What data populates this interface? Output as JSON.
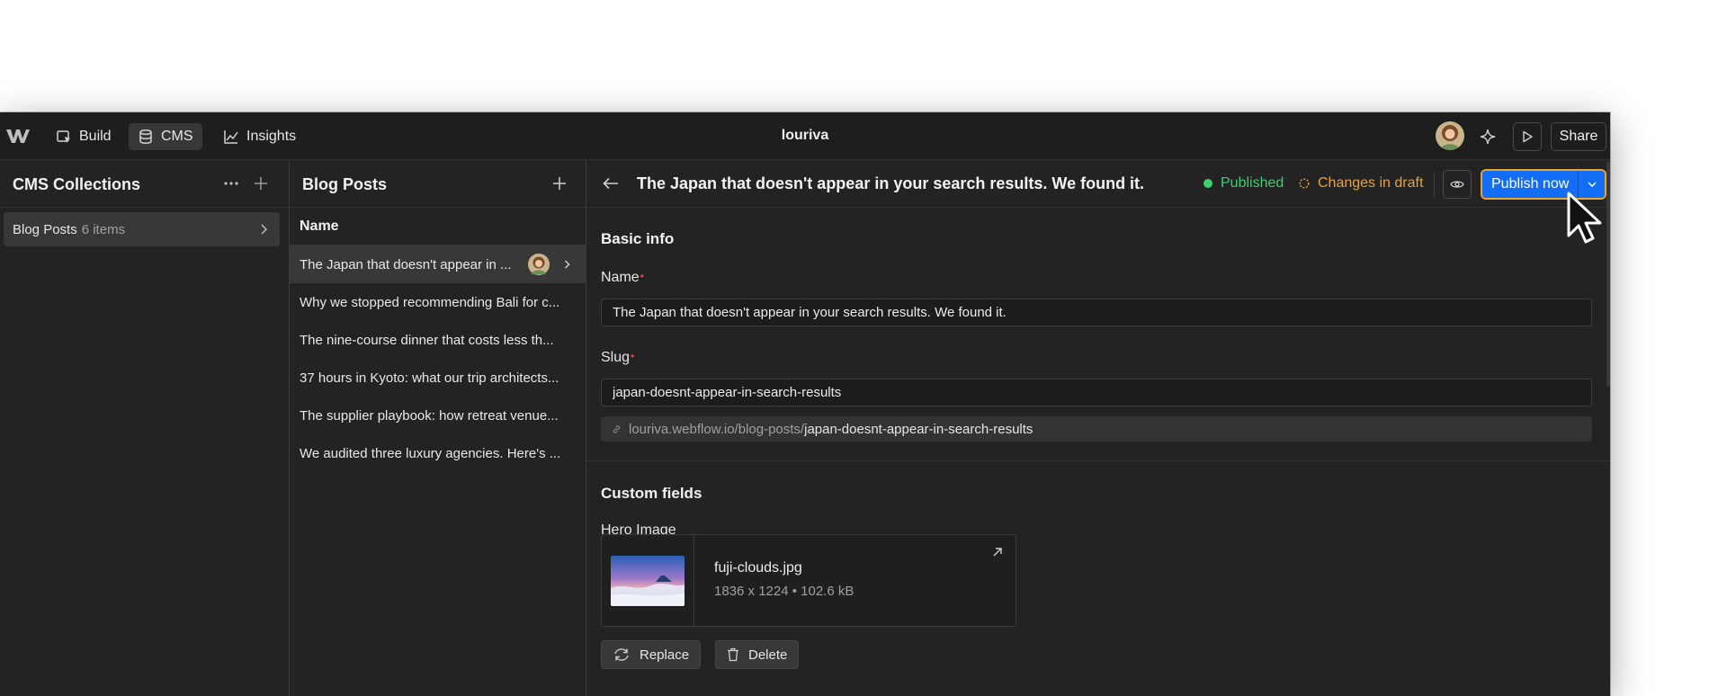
{
  "topbar": {
    "nav": [
      {
        "label": "Build",
        "icon": "build-icon"
      },
      {
        "label": "CMS",
        "icon": "database-icon"
      },
      {
        "label": "Insights",
        "icon": "chart-icon"
      }
    ],
    "site_name": "louriva",
    "share_label": "Share"
  },
  "collections_panel": {
    "title": "CMS Collections",
    "items": [
      {
        "name": "Blog Posts",
        "count": "6 items"
      }
    ]
  },
  "posts_panel": {
    "title": "Blog Posts",
    "column_header": "Name",
    "rows": [
      "The Japan that doesn't appear in ...",
      "Why we stopped recommending Bali for c...",
      "The nine-course dinner that costs less th...",
      "37 hours in Kyoto: what our trip architects...",
      "The supplier playbook: how retreat venue...",
      "We audited three luxury agencies. Here's ..."
    ]
  },
  "editor": {
    "title": "The Japan that doesn't appear in your search results. We found it.",
    "status_published": "Published",
    "status_draft": "Changes in draft",
    "publish_label": "Publish now",
    "basic_info": {
      "heading": "Basic info",
      "name_label": "Name",
      "name_value": "The Japan that doesn't appear in your search results. We found it.",
      "slug_label": "Slug",
      "slug_value": "japan-doesnt-appear-in-search-results",
      "url_prefix": "louriva.webflow.io/blog-posts/",
      "url_slug": "japan-doesnt-appear-in-search-results"
    },
    "custom_fields": {
      "heading": "Custom fields",
      "hero_label": "Hero Image",
      "file_name": "fuji-clouds.jpg",
      "file_meta": "1836 x 1224 • 102.6 kB",
      "replace_label": "Replace",
      "delete_label": "Delete"
    }
  },
  "colors": {
    "accent": "#146ef5",
    "published": "#3ecf6e",
    "draft": "#e8a23a",
    "focus_ring": "#e8a632",
    "background": "#232323"
  }
}
